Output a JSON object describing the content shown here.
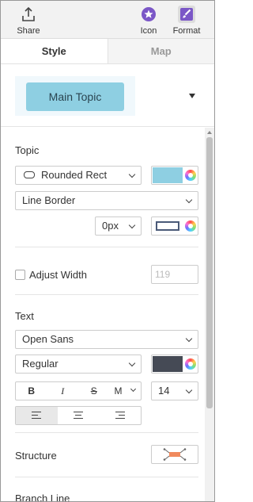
{
  "toolbar": {
    "share_label": "Share",
    "icon_label": "Icon",
    "format_label": "Format"
  },
  "tabs": {
    "style": "Style",
    "map": "Map"
  },
  "preview": {
    "topic_label": "Main Topic"
  },
  "topic": {
    "title": "Topic",
    "shape": "Rounded Rect",
    "fill_color": "#8ecfe2",
    "border_style": "Line Border",
    "border_width": "0px"
  },
  "adjust_width": {
    "label": "Adjust Width",
    "value": "119",
    "checked": false
  },
  "text": {
    "title": "Text",
    "font": "Open Sans",
    "weight": "Regular",
    "color": "#454a55",
    "bold": "B",
    "italic": "I",
    "strike": "S",
    "more": "M",
    "size": "14"
  },
  "structure": {
    "title": "Structure",
    "line_color": "#f08a5d"
  },
  "branch_line": {
    "title": "Branch Line"
  },
  "colors": {
    "accent": "#7b57c7",
    "topic_fill": "#8ecfe2"
  }
}
